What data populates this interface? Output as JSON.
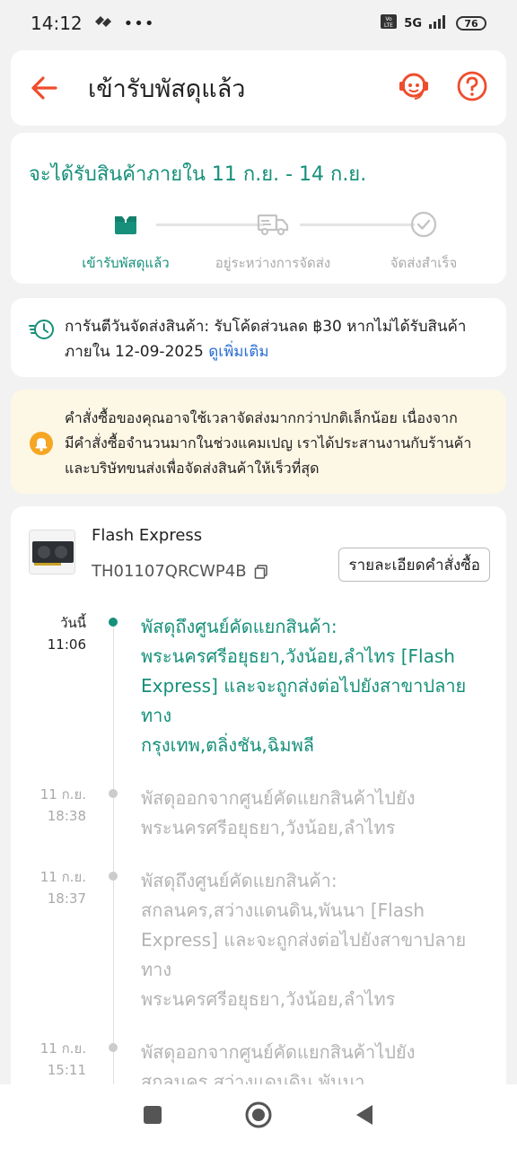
{
  "status_bar": {
    "time": "14:12",
    "network": "5G",
    "battery": "76"
  },
  "header": {
    "title": "เข้ารับพัสดุแล้ว"
  },
  "status": {
    "eta": "จะได้รับสินค้าภายใน 11 ก.ย. - 14 ก.ย.",
    "steps": [
      {
        "label": "เข้ารับพัสดุแล้ว"
      },
      {
        "label": "อยู่ระหว่างการจัดส่ง"
      },
      {
        "label": "จัดส่งสำเร็จ"
      }
    ]
  },
  "guarantee": {
    "line1": "การันตีวันจัดส่งสินค้า: รับโค้ดส่วนลด ฿30 หากไม่ได้รับสินค้า",
    "line2": "ภายใน 12-09-2025 ",
    "link": "ดูเพิ่มเติม"
  },
  "notice": {
    "line1": "คำสั่งซื้อของคุณอาจใช้เวลาจัดส่งมากกว่าปกติเล็กน้อย เนื่องจาก",
    "line2": "มีคำสั่งซื้อจำนวนมากในช่วงแคมเปญ เราได้ประสานงานกับร้านค้า",
    "line3": "และบริษัทขนส่งเพื่อจัดส่งสินค้าให้เร็วที่สุด"
  },
  "shipment": {
    "carrier": "Flash Express",
    "tracking_number": "TH01107QRCWP4B",
    "order_details_label": "รายละเอียดคำสั่งซื้อ",
    "events": [
      {
        "date": "วันนี้",
        "time": "11:06",
        "lines": [
          "พัสดุถึงศูนย์คัดแยกสินค้า:",
          "พระนครศรีอยุธยา,วังน้อย,ลำไทร [Flash",
          "Express] และจะถูกส่งต่อไปยังสาขาปลายทาง",
          "กรุงเทพ,ตลิ่งชัน,ฉิมพลี"
        ]
      },
      {
        "date": "11 ก.ย.",
        "time": "18:38",
        "lines": [
          "พัสดุออกจากศูนย์คัดแยกสินค้าไปยัง",
          "พระนครศรีอยุธยา,วังน้อย,ลำไทร"
        ]
      },
      {
        "date": "11 ก.ย.",
        "time": "18:37",
        "lines": [
          "พัสดุถึงศูนย์คัดแยกสินค้า:",
          "สกลนคร,สว่างแดนดิน,พันนา [Flash",
          "Express] และจะถูกส่งต่อไปยังสาขาปลายทาง",
          "พระนครศรีอยุธยา,วังน้อย,ลำไทร"
        ]
      },
      {
        "date": "11 ก.ย.",
        "time": "15:11",
        "lines": [
          "พัสดุออกจากศูนย์คัดแยกสินค้าไปยัง",
          "สกลนคร,สว่างแดนดิน,พันนา"
        ]
      }
    ]
  },
  "colors": {
    "accent_green": "#16907a",
    "brand_orange": "#ee4d2d",
    "link_blue": "#2a6ed2",
    "notice_bg": "#fdf7e6"
  },
  "icons": {
    "back": "arrow-left-icon",
    "support": "headset-icon",
    "help": "question-circle-icon",
    "step1": "package-icon",
    "step2": "truck-icon",
    "step3": "check-circle-icon",
    "guarantee": "fast-clock-icon",
    "notice": "bell-icon",
    "copy": "copy-icon"
  }
}
